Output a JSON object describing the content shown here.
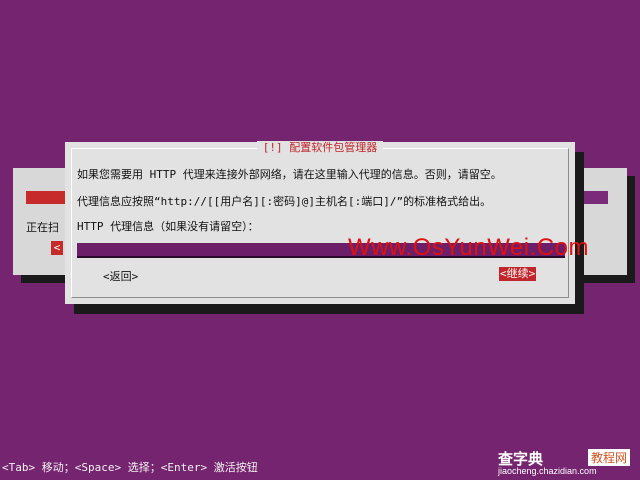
{
  "background_dialog": {
    "scanning_text": "正在扫",
    "button_glyph": "<"
  },
  "dialog": {
    "title": "[!] 配置软件包管理器",
    "line1": "如果您需要用 HTTP 代理来连接外部网络，请在这里输入代理的信息。否则，请留空。",
    "line2": "代理信息应按照“http://[[用户名][:密码]@]主机名[:端口]/”的标准格式给出。",
    "field_label": "HTTP 代理信息（如果没有请留空）：",
    "field_value": "",
    "back_button": "<返回>",
    "continue_button": "<继续>"
  },
  "watermark": "Www.OsYunWei.Com",
  "hint_bar": "<Tab> 移动；<Space> 选择；<Enter> 激活按钮",
  "site_logo": {
    "main": "查字典",
    "sub": "教程网",
    "url": "jiaocheng.chazidian.com"
  },
  "colors": {
    "background": "#75246f",
    "dialog": "#e2e2e2",
    "accent_red": "#c0262b",
    "input": "#6c1f68"
  }
}
